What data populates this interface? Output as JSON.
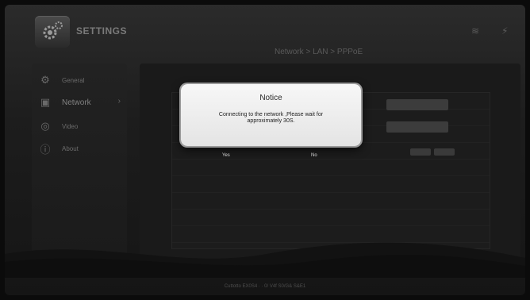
{
  "app": {
    "title": "SETTINGS"
  },
  "breadcrumb": "Network > LAN > PPPoE",
  "sidebar": {
    "items": [
      {
        "label": "General",
        "icon": "gear-icon"
      },
      {
        "label": "Network",
        "icon": "network-icon",
        "arrow": "›"
      },
      {
        "label": "Video",
        "icon": "video-icon"
      },
      {
        "label": "About",
        "icon": "info-icon"
      }
    ]
  },
  "dialog": {
    "title": "Notice",
    "message": "Connecting to the network ,Please wait for approximately 30S.",
    "yes_label": "Yes",
    "no_label": "No"
  },
  "status_bar": {
    "text": "Cuttotto   EX0S4   · ·   0/   V4f   S0/G&   S&E1"
  },
  "colors": {
    "dialog_bg": "#efefef",
    "screen_bg": "#1b1b1b"
  }
}
